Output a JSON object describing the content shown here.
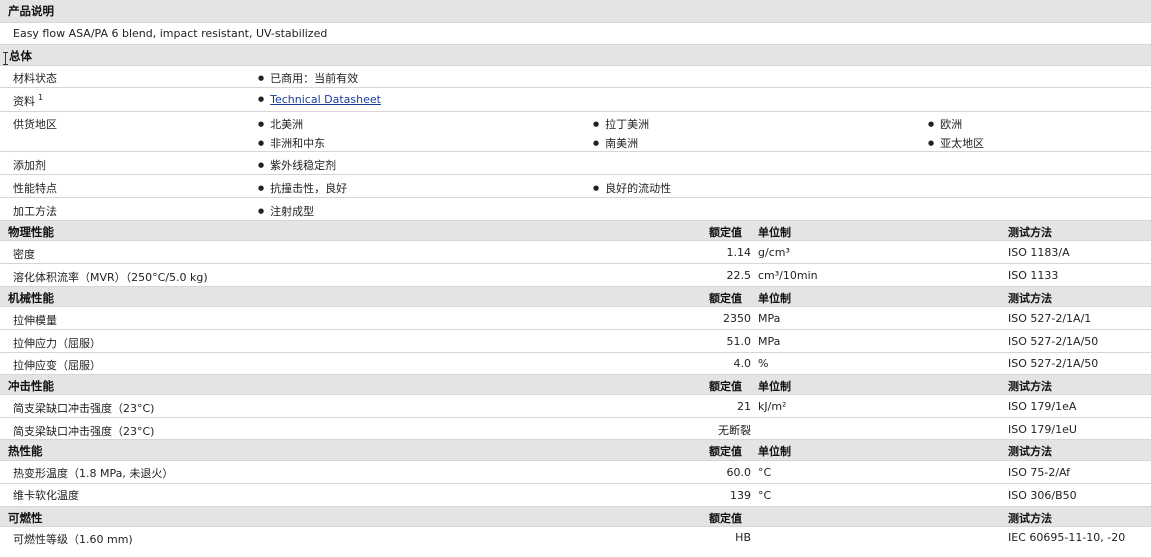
{
  "description": {
    "header": "产品说明",
    "text": "Easy flow ASA/PA 6 blend, impact resistant, UV-stabilized"
  },
  "general": {
    "header": "总体",
    "rows": [
      {
        "label": "材料状态",
        "items": [
          "已商用：当前有效"
        ]
      },
      {
        "label": "资料",
        "superscript": "1",
        "link": "Technical Datasheet"
      },
      {
        "label": "供货地区",
        "items": [
          "北美洲",
          "拉丁美洲",
          "欧洲",
          "非洲和中东",
          "南美洲",
          "亚太地区"
        ]
      },
      {
        "label": "添加剂",
        "items": [
          "紫外线稳定剂"
        ]
      },
      {
        "label": "性能特点",
        "items": [
          "抗撞击性，良好",
          "良好的流动性"
        ]
      },
      {
        "label": "加工方法",
        "items": [
          "注射成型"
        ]
      }
    ]
  },
  "columns": {
    "value": "额定值",
    "unit": "单位制",
    "method": "测试方法"
  },
  "physical": {
    "header": "物理性能",
    "rows": [
      {
        "label": "密度",
        "value": "1.14",
        "unit": "g/cm³",
        "method": "ISO 1183/A"
      },
      {
        "label": "溶化体积流率（MVR）（250°C/5.0 kg)",
        "value": "22.5",
        "unit": "cm³/10min",
        "method": "ISO 1133"
      }
    ]
  },
  "mechanical": {
    "header": "机械性能",
    "rows": [
      {
        "label": "拉伸模量",
        "value": "2350",
        "unit": "MPa",
        "method": "ISO 527-2/1A/1"
      },
      {
        "label": "拉伸应力（屈服）",
        "value": "51.0",
        "unit": "MPa",
        "method": "ISO 527-2/1A/50"
      },
      {
        "label": "拉伸应变（屈服）",
        "value": "4.0",
        "unit": "%",
        "method": "ISO 527-2/1A/50"
      }
    ]
  },
  "impact": {
    "header": "冲击性能",
    "rows": [
      {
        "label": "简支梁缺口冲击强度（23°C)",
        "value": "21",
        "unit": "kJ/m²",
        "method": "ISO 179/1eA"
      },
      {
        "label": "简支梁缺口冲击强度（23°C)",
        "value": "无断裂",
        "unit": "",
        "method": "ISO 179/1eU"
      }
    ]
  },
  "thermal": {
    "header": "热性能",
    "rows": [
      {
        "label": "热变形温度（1.8 MPa, 未退火）",
        "value": "60.0",
        "unit": "°C",
        "method": "ISO 75-2/Af"
      },
      {
        "label": "维卡软化温度",
        "value": "139",
        "unit": "°C",
        "method": "ISO 306/B50"
      }
    ]
  },
  "flammability": {
    "header": "可燃性",
    "rows": [
      {
        "label": "可燃性等级（1.60 mm)",
        "value": "HB",
        "unit": "",
        "method": "IEC 60695-11-10, -20"
      }
    ]
  }
}
